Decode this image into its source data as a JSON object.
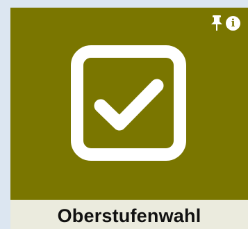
{
  "tile": {
    "label": "Oberstufenwahl",
    "main_icon": "checkbox-checked-icon",
    "colors": {
      "tile_background": "#7a7600",
      "footer_background": "#ebebde",
      "page_background": "#dce6f1",
      "icon_color": "#ffffff"
    },
    "actions": {
      "pin_icon": "pin-icon",
      "info_icon": "info-icon",
      "info_glyph": "i"
    }
  }
}
